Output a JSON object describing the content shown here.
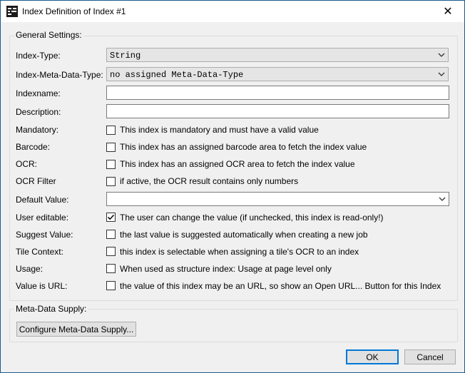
{
  "window": {
    "title": "Index Definition of Index #1",
    "close_glyph": "✕"
  },
  "general": {
    "group_label": "General Settings:",
    "index_type": {
      "label": "Index-Type:",
      "value": "String"
    },
    "meta_type": {
      "label": "Index-Meta-Data-Type:",
      "value": "no assigned Meta-Data-Type"
    },
    "indexname": {
      "label": "Indexname:",
      "value": ""
    },
    "description": {
      "label": "Description:",
      "value": ""
    },
    "mandatory": {
      "label": "Mandatory:",
      "text": "This index is mandatory and must have a valid value",
      "checked": false
    },
    "barcode": {
      "label": "Barcode:",
      "text": "This index has an assigned barcode area to fetch the index value",
      "checked": false
    },
    "ocr": {
      "label": "OCR:",
      "text": "This index has an assigned OCR area to fetch the index value",
      "checked": false
    },
    "ocr_filter": {
      "label": "OCR Filter",
      "text": "if active, the OCR result contains only numbers",
      "checked": false
    },
    "default_value": {
      "label": "Default Value:",
      "value": ""
    },
    "user_editable": {
      "label": "User editable:",
      "text": "The user can change the value (if unchecked, this index is read-only!)",
      "checked": true
    },
    "suggest_value": {
      "label": "Suggest Value:",
      "text": "the last value is suggested automatically when creating a new job",
      "checked": false
    },
    "tile_context": {
      "label": "Tile Context:",
      "text": "this index is selectable when assigning a tile's OCR to an index",
      "checked": false
    },
    "usage": {
      "label": "Usage:",
      "text": "When used as structure index: Usage at page level only",
      "checked": false
    },
    "value_is_url": {
      "label": "Value is URL:",
      "text": "the value  of this index may be an URL, so show an Open URL... Button for this Index",
      "checked": false
    }
  },
  "meta_supply": {
    "group_label": "Meta-Data Supply:",
    "configure_label": "Configure Meta-Data Supply..."
  },
  "buttons": {
    "ok": "OK",
    "cancel": "Cancel"
  },
  "colors": {
    "accent": "#0078d7",
    "frame": "#1c5a8a",
    "dialog_bg": "#f0f0f0"
  },
  "icons": {
    "app": "app-form-icon",
    "close": "close-icon",
    "dropdown": "chevron-down-icon",
    "check": "checkmark-icon"
  }
}
